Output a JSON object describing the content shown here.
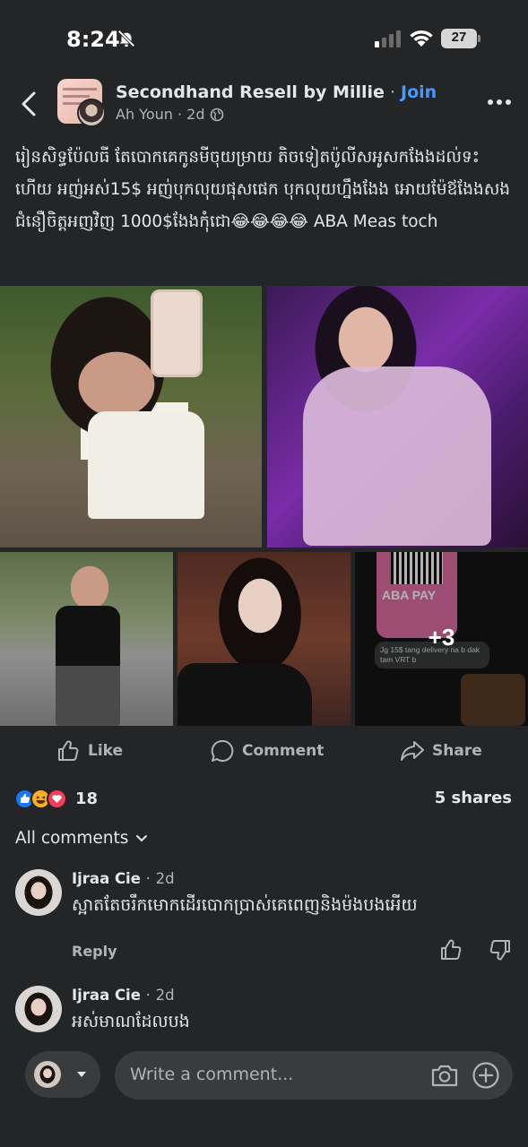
{
  "status_bar": {
    "time": "8:24",
    "battery": "27"
  },
  "header": {
    "group_name": "Secondhand Resell by Millie",
    "separator": "·",
    "join_label": "Join",
    "author": "Ah Youn",
    "time_ago": "2d"
  },
  "post": {
    "text": "រៀនសិទ្ធប៉ែលធី តែបោកគេកូនមីចុយម្រាយ តិចទៀតប៉ូលីសអូសកងែងដល់ទះហើយ អញ់អស់15$ អញ់បុកលុយផុសផេក បុកលុយហ្នឹងងែង អោយម៉ែឪងែងសងជំនឿចិត្តអញវិញ 1000$ងែងកុំជោ😂😂😂😂 ABA Meas toch",
    "photos_more": "+3",
    "photo5_banner": "ABA PAY",
    "photo5_message": "Jg 15$ tang delivery na b dak tam VRT b"
  },
  "actions": {
    "like": "Like",
    "comment": "Comment",
    "share": "Share"
  },
  "engagement": {
    "reaction_count": "18",
    "shares": "5 shares",
    "reaction_types": [
      "like",
      "haha",
      "love"
    ],
    "colors": {
      "like": "#1877f2",
      "haha": "#f7b125",
      "love": "#f33e58"
    }
  },
  "comments_header": {
    "label": "All comments"
  },
  "comments": [
    {
      "name": "Ijraa Cie",
      "time": "2d",
      "text": "ស្អាតតែចរឹកមោកដើរបោកប្រាស់គេពេញនិងម៉ងបងអើយ",
      "reply": "Reply"
    },
    {
      "name": "Ijraa Cie",
      "time": "2d",
      "text": "អស់មាណដែលបង"
    }
  ],
  "composer": {
    "placeholder": "Write a comment..."
  },
  "theme": {
    "background": "#242527",
    "link": "#4599ff",
    "muted": "#b0b3b8"
  }
}
